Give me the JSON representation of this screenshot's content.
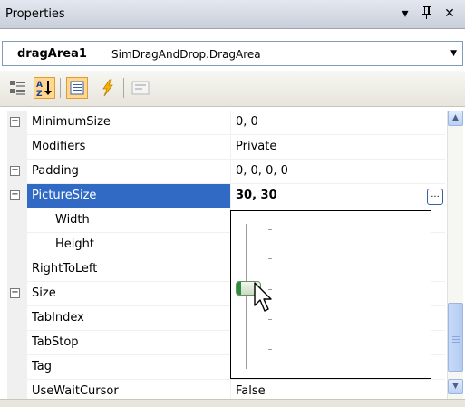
{
  "window": {
    "title": "Properties",
    "dropdown_icon": "triangle-down",
    "pin_icon": "pin",
    "close_icon": "close"
  },
  "object_selector": {
    "name": "dragArea1",
    "type": "SimDragAndDrop.DragArea"
  },
  "toolbar": {
    "buttons": [
      {
        "icon": "categorized-icon",
        "active": false
      },
      {
        "icon": "alphabetical-icon",
        "active": true
      },
      {
        "icon": "properties-icon",
        "active": true
      },
      {
        "icon": "events-icon",
        "active": false
      },
      {
        "icon": "property-pages-icon",
        "active": false
      }
    ]
  },
  "grid": {
    "rows": [
      {
        "name": "MinimumSize",
        "value": "0, 0",
        "expandable": true,
        "expanded": false
      },
      {
        "name": "Modifiers",
        "value": "Private",
        "expandable": false
      },
      {
        "name": "Padding",
        "value": "0, 0, 0, 0",
        "expandable": true,
        "expanded": false
      },
      {
        "name": "PictureSize",
        "value": "30, 30",
        "expandable": true,
        "expanded": true,
        "selected": true,
        "ellipsis": "..."
      },
      {
        "name": "Width",
        "value": "",
        "sub": true
      },
      {
        "name": "Height",
        "value": "",
        "sub": true
      },
      {
        "name": "RightToLeft",
        "value": ""
      },
      {
        "name": "Size",
        "value": "",
        "expandable": true,
        "expanded": false
      },
      {
        "name": "TabIndex",
        "value": ""
      },
      {
        "name": "TabStop",
        "value": ""
      },
      {
        "name": "Tag",
        "value": ""
      },
      {
        "name": "UseWaitCursor",
        "value": "False"
      }
    ],
    "expand_symbol": "+",
    "collapse_symbol": "−"
  },
  "slider": {
    "level": 0.5,
    "ticks": 5
  },
  "colors": {
    "selection": "#316ac5",
    "thumb_accent": "#2f8b3f"
  }
}
